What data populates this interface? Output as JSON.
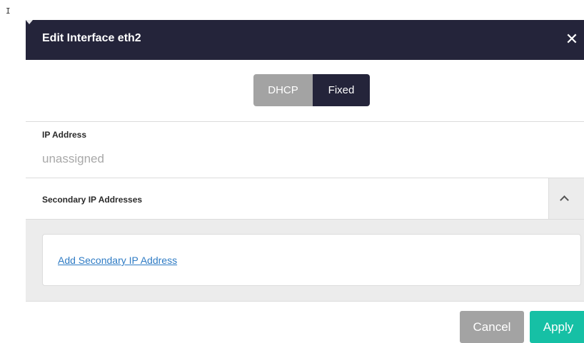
{
  "cursor_glyph": "I",
  "dialog": {
    "title": "Edit Interface eth2",
    "close_glyph": "✕",
    "mode_toggle": {
      "options": [
        "DHCP",
        "Fixed"
      ],
      "selected": "Fixed"
    },
    "ip_address": {
      "label": "IP Address",
      "value": "unassigned"
    },
    "secondary": {
      "label": "Secondary IP Addresses",
      "expanded": true,
      "add_link": "Add Secondary IP Address"
    },
    "buttons": {
      "cancel": "Cancel",
      "apply": "Apply"
    }
  },
  "colors": {
    "header": "#24243a",
    "toggle_inactive": "#a3a3a3",
    "toggle_active": "#24243a",
    "link": "#2e7bc4",
    "apply": "#16c0a5",
    "cancel": "#a3a3a3"
  },
  "icons": {
    "close": "close-icon",
    "chevron": "chevron-up-icon"
  }
}
